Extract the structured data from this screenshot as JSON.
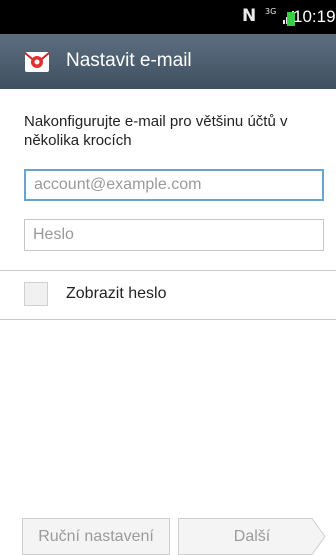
{
  "status_bar": {
    "carrier_glyph": "N",
    "network_label": "3G",
    "time": "10:19",
    "battery_color": "#36d044"
  },
  "header": {
    "title": "Nastavit e-mail",
    "icon": "email-app-icon"
  },
  "form": {
    "instructions": "Nakonfigurujte e-mail pro většinu účtů v několika krocích",
    "email_placeholder": "account@example.com",
    "password_placeholder": "Heslo",
    "show_password_label": "Zobrazit heslo",
    "show_password_checked": false
  },
  "footer": {
    "manual_setup_label": "Ruční nastavení",
    "next_label": "Další"
  },
  "colors": {
    "action_bar": "#4a5b6c",
    "focus_border": "#6aa4cc",
    "disabled_text": "#9b9b9b"
  }
}
